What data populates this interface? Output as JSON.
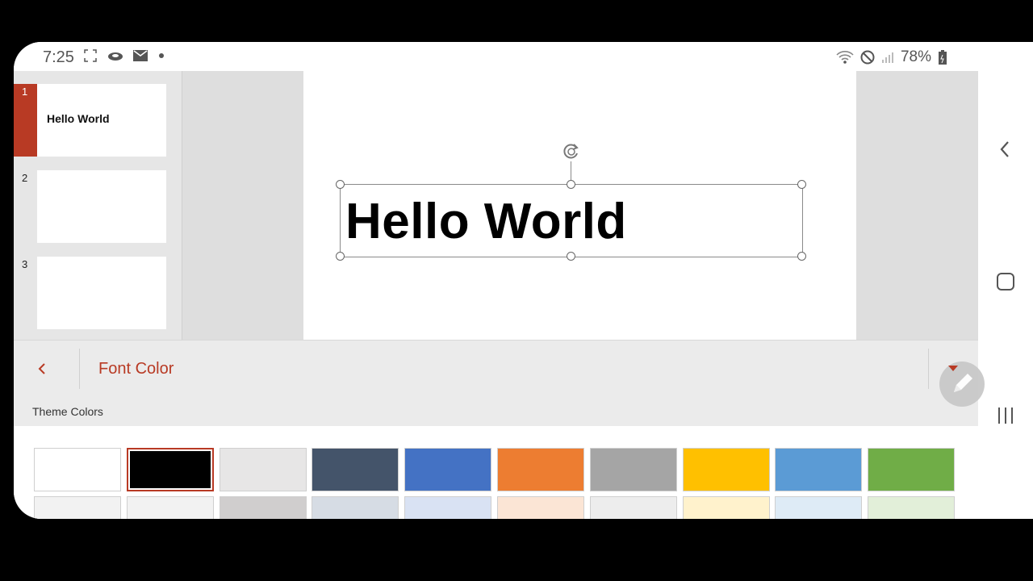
{
  "status_bar": {
    "time": "7:25",
    "battery": "78%",
    "left_icons": [
      "screenshot-icon",
      "cloud-icon",
      "mail-icon",
      "dot-icon"
    ],
    "right_icons": [
      "wifi-icon",
      "do-not-disturb-icon",
      "signal-icon",
      "battery-icon"
    ]
  },
  "slides": [
    {
      "number": "1",
      "title": "Hello World",
      "selected": true
    },
    {
      "number": "2",
      "title": ""
    },
    {
      "number": "3",
      "title": ""
    }
  ],
  "slide_canvas": {
    "textbox_text": "Hello World"
  },
  "panel": {
    "title": "Font Color",
    "section_label": "Theme Colors",
    "theme_colors_row1": [
      "#ffffff",
      "#000000",
      "#e7e6e6",
      "#44546a",
      "#4472c4",
      "#ed7d31",
      "#a5a5a5",
      "#ffc000",
      "#5b9bd5",
      "#70ad47"
    ],
    "theme_colors_row2": [
      "#f2f2f2",
      "#f2f2f2",
      "#d0cece",
      "#d6dce4",
      "#d9e2f3",
      "#fbe5d5",
      "#ededed",
      "#fff2cc",
      "#deebf6",
      "#e2efd9"
    ],
    "selected_color": "#000000"
  },
  "colors": {
    "accent": "#b83a24"
  },
  "nav": {
    "icons": [
      "back-nav-icon",
      "home-nav-icon",
      "recents-nav-icon"
    ]
  }
}
